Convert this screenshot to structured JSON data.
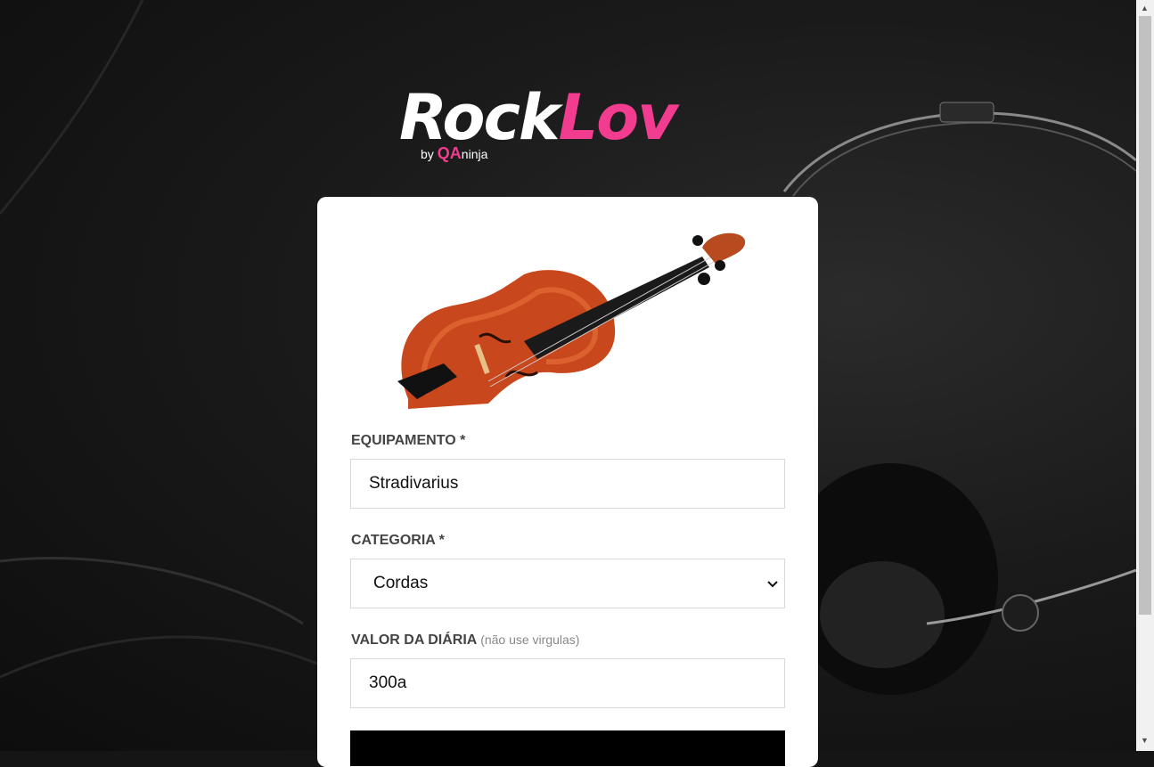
{
  "brand": {
    "part1": "Rock",
    "part2": "Lov",
    "by": "by",
    "qa": "QA",
    "ninja": "ninja",
    "accent": "#f23c8f"
  },
  "form": {
    "equipment_label": "EQUIPAMENTO *",
    "equipment_value": "Stradivarius",
    "category_label": "CATEGORIA *",
    "category_value": "Cordas",
    "price_label": "VALOR DA DIÁRIA",
    "price_hint": "(não use virgulas)",
    "price_value": "300a"
  },
  "icons": {
    "select": "chevron-down-icon",
    "scroll_up": "scroll-up-arrow-icon",
    "scroll_down": "scroll-down-arrow-icon",
    "thumbnail": "violin-image"
  }
}
